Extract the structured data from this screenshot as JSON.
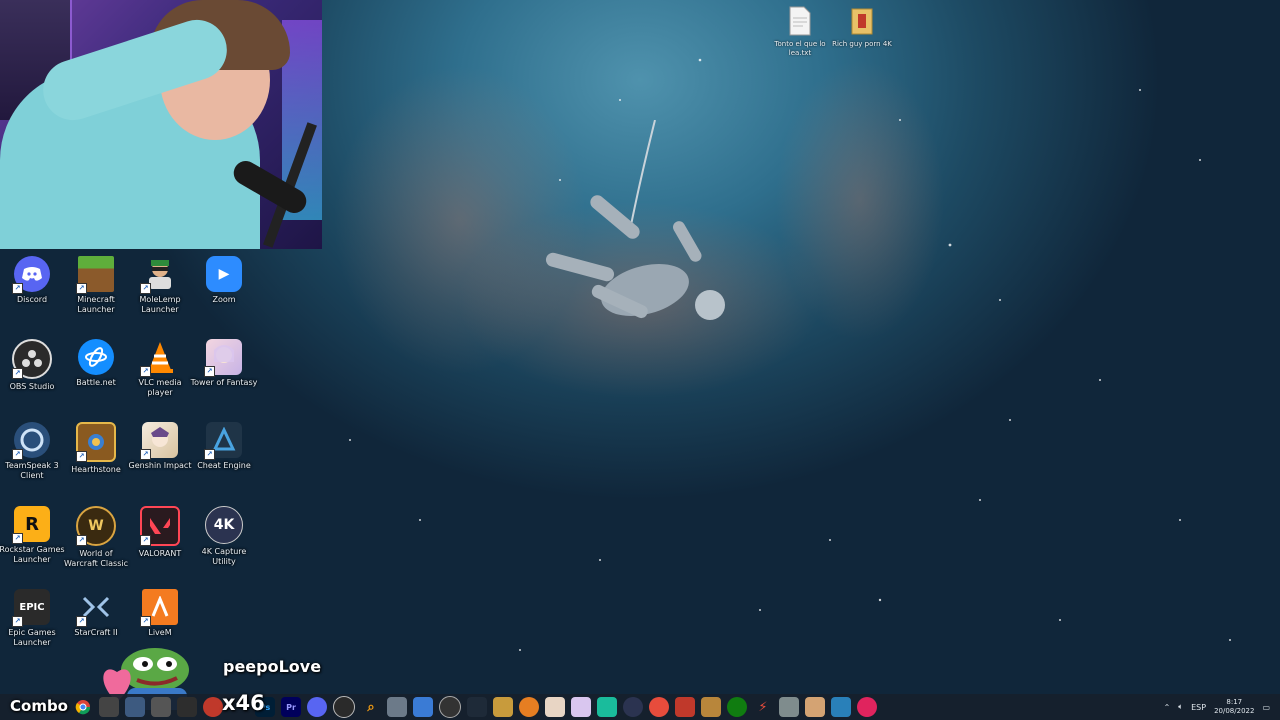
{
  "desktop": {
    "top_files": [
      {
        "label": "Tonto el que lo lea.txt"
      },
      {
        "label": "Rich guy porn 4K"
      }
    ],
    "icons": [
      {
        "label": "Discord"
      },
      {
        "label": "Minecraft Launcher"
      },
      {
        "label": "MoleLemp Launcher"
      },
      {
        "label": "Zoom"
      },
      {
        "label": "OBS Studio"
      },
      {
        "label": "Battle.net"
      },
      {
        "label": "VLC media player"
      },
      {
        "label": "Tower of Fantasy"
      },
      {
        "label": "TeamSpeak 3 Client"
      },
      {
        "label": "Hearthstone"
      },
      {
        "label": "Genshin Impact"
      },
      {
        "label": "Cheat Engine"
      },
      {
        "label": "Rockstar Games Launcher"
      },
      {
        "label": "World of Warcraft Classic"
      },
      {
        "label": "VALORANT"
      },
      {
        "label": "4K Capture Utility"
      },
      {
        "label": "Epic Games Launcher"
      },
      {
        "label": "StarCraft II"
      },
      {
        "label": "LiveM"
      }
    ],
    "icon_texts": {
      "zoom": "▶",
      "4k": "4K",
      "epic": "EPIC",
      "rockstar": "R"
    }
  },
  "overlay": {
    "emote_name": "peepoLove",
    "combo_label": "Combo",
    "combo_count": "x46"
  },
  "taskbar": {
    "tray_lang": "ESP",
    "clock_time": "8:17",
    "clock_date": "20/08/2022"
  }
}
